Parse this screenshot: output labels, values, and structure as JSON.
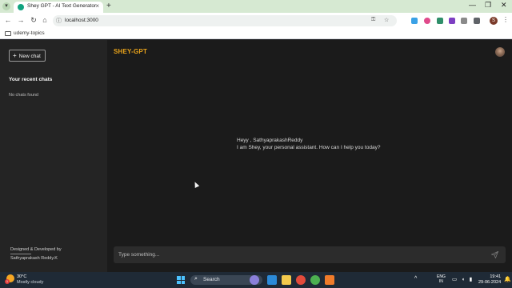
{
  "browser": {
    "tab_title": "Shey GPT - AI Text Generator",
    "url": "localhost:3000",
    "bookmark_label": "udemy-topics",
    "profile_initial": "S"
  },
  "sidebar": {
    "new_chat_label": "New chat",
    "recent_title": "Your recent chats",
    "empty_text": "No chats found",
    "credit_label": "Designed & Developed by",
    "credit_name": "Sathyaprakash Reddy.K"
  },
  "header": {
    "brand": "SHEY-GPT"
  },
  "main": {
    "greeting": "Heyy , SathyaprakashReddy",
    "intro": "I am Shey, your personal assistant. How can I help you today?"
  },
  "composer": {
    "placeholder": "Type something..."
  },
  "taskbar": {
    "temperature": "30°C",
    "weather": "Mostly cloudy",
    "weather_badge": "1",
    "search_label": "Search",
    "lang_line1": "ENG",
    "lang_line2": "IN",
    "time": "19:41",
    "date": "29-06-2024"
  },
  "colors": {
    "brand": "#e9a31b",
    "sidebar_bg": "#242424",
    "main_bg": "#1b1b1b",
    "tabstrip_bg": "#d6e9d2"
  }
}
